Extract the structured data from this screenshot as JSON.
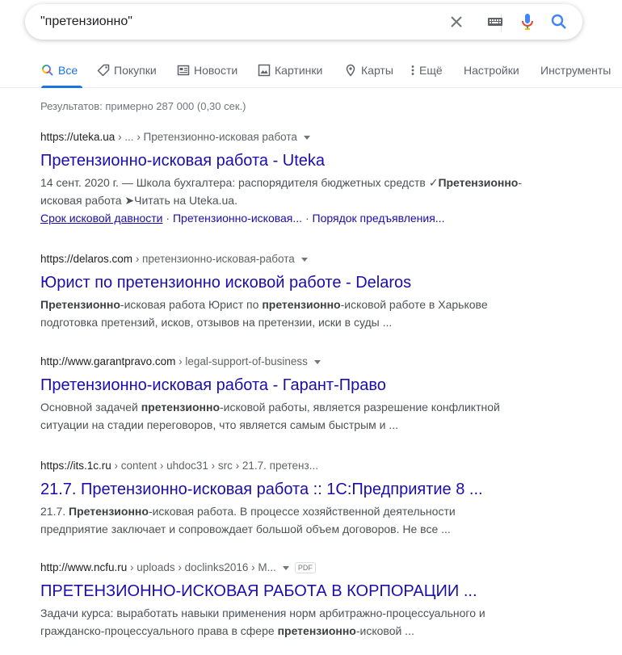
{
  "search": {
    "query": "\"претензионно\""
  },
  "tabs": [
    {
      "label": "Все",
      "icon": "search-icon",
      "active": true
    },
    {
      "label": "Покупки",
      "icon": "tag-icon"
    },
    {
      "label": "Новости",
      "icon": "news-icon"
    },
    {
      "label": "Картинки",
      "icon": "image-icon"
    },
    {
      "label": "Карты",
      "icon": "map-pin-icon"
    },
    {
      "label": "Ещё",
      "icon": "more-vert-icon"
    },
    {
      "label": "Настройки"
    },
    {
      "label": "Инструменты"
    }
  ],
  "stats": "Результатов: примерно 287 000 (0,30 сек.)",
  "results": [
    {
      "domain": "https://uteka.ua",
      "path": " › ... › Претензионно-исковая работа",
      "title": "Претензионно-исковая работа - Uteka",
      "snippet_parts": [
        "14 сент. 2020 г. — Школа бухгалтера: распорядителя бюджетных средств ✓",
        "Претензионно",
        "-исковая работа ➤Читать на Uteka.ua."
      ],
      "sitelinks": [
        "Срок исковой давности",
        "Претензионно-исковая...",
        "Порядок предъявления..."
      ],
      "sitelink_sep": " · "
    },
    {
      "domain": "https://delaros.com",
      "path": " › претензионно-исковая-работа",
      "title": "Юрист по претензионно исковой работе - Delaros",
      "snippet_parts": [
        "",
        "Претензионно",
        "-исковая работа Юрист по ",
        "претензионно",
        "-исковой работе в Харькове подготовка претензий, исков, отзывов на претензии, иски в суды ..."
      ]
    },
    {
      "domain": "http://www.garantpravo.com",
      "path": " › legal-support-of-business",
      "title": "Претензионно-исковая работа - Гарант-Право",
      "snippet_parts": [
        "Основной задачей ",
        "претензионно",
        "-исковой работы, является разрешение конфликтной ситуации на стадии переговоров, что является самым быстрым и ..."
      ]
    },
    {
      "domain": "https://its.1c.ru",
      "path": " › content › uhdoc31 › src › 21.7. претенз...",
      "title": "21.7. Претензионно-исковая работа :: 1С:Предприятие 8 ...",
      "snippet_parts": [
        "21.7. ",
        "Претензионно",
        "-исковая работа. В процессе хозяйственной деятельности предприятие заключает и сопровождает большой объем договоров. Не все ..."
      ]
    },
    {
      "domain": "http://www.ncfu.ru",
      "path": " › uploads › doclinks2016 › M...",
      "badge": "PDF",
      "title": "ПРЕТЕНЗИОННО-ИСКОВАЯ РАБОТА В КОРПОРАЦИИ ...",
      "snippet_parts": [
        "Задачи курса: выработать навыки применения норм арбитражно-процессуального и гражданско-процессуального права в сфере ",
        "претензионно",
        "-исковой ..."
      ]
    }
  ],
  "colors": {
    "link": "#1a0dab",
    "accent": "#1a73e8",
    "snippet": "#4d5156",
    "muted": "#70757a"
  }
}
